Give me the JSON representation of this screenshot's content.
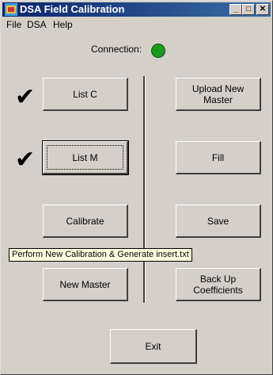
{
  "window": {
    "title": "DSA Field Calibration",
    "buttons": {
      "minimize": "_",
      "maximize": "□",
      "close": "✕"
    }
  },
  "menu": [
    {
      "label": "File"
    },
    {
      "label": "DSA"
    },
    {
      "label": "Help"
    }
  ],
  "connection": {
    "label": "Connection:",
    "status_color": "#1c9a1c"
  },
  "left_buttons": {
    "list_c": "List C",
    "list_m": "List M",
    "calibrate": "Calibrate",
    "new_master": "New Master"
  },
  "right_buttons": {
    "upload_new_master": "Upload New\nMaster",
    "fill": "Fill",
    "save": "Save",
    "back_up_coefficients": "Back Up\nCoefficients"
  },
  "exit_label": "Exit",
  "checkmarks": {
    "list_c": "✔",
    "list_m": "✔"
  },
  "tooltip": "Perform New Calibration & Generate insert.txt"
}
